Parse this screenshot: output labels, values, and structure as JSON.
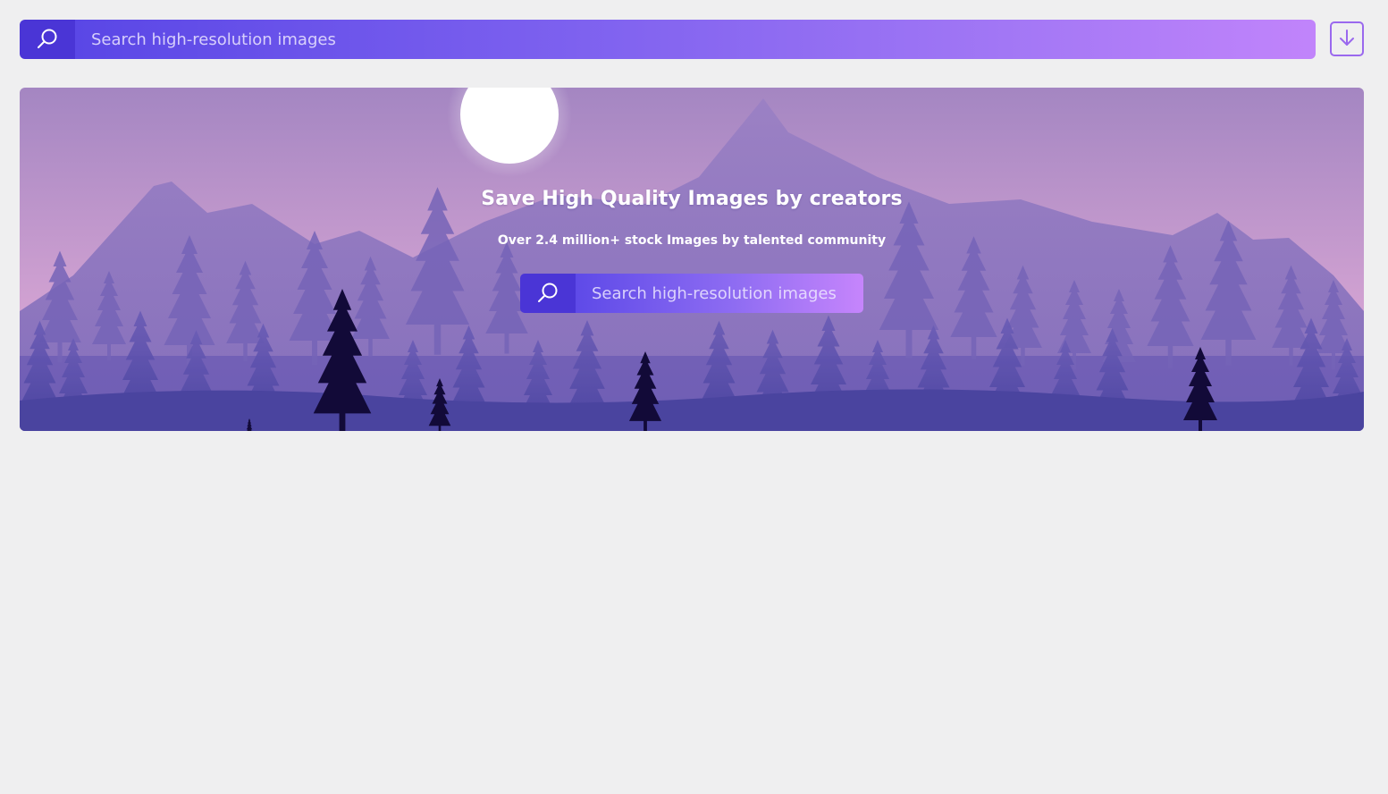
{
  "header": {
    "search": {
      "placeholder": "Search high-resolution images",
      "icon": "search-icon"
    },
    "download_icon": "download-icon"
  },
  "hero": {
    "title": "Save High Quality Images by creators",
    "subtitle": "Over 2.4 million+ stock Images by talented community",
    "search": {
      "placeholder": "Search high-resolution images",
      "icon": "search-icon"
    },
    "background": "mountain-forest-illustration"
  },
  "colors": {
    "page_background": "#efeff0",
    "search_button": "#4a35d6",
    "gradient_start": "#5a47e6",
    "gradient_end": "#c184fb",
    "download_border": "#9a68ee",
    "moon": "#ffffff",
    "sky_top": "#a486c2",
    "sky_bottom": "#d7a6d4"
  }
}
